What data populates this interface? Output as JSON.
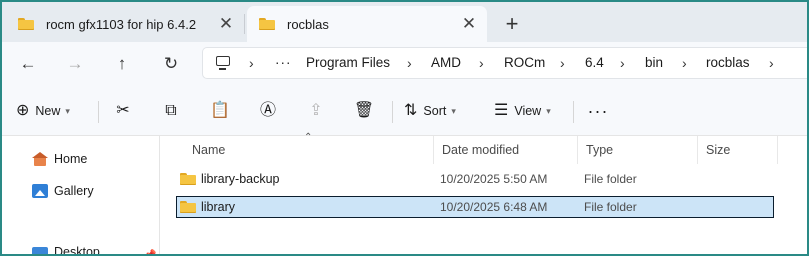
{
  "tabs": [
    {
      "label": "rocm gfx1103 for hip 6.4.2",
      "active": false
    },
    {
      "label": "rocblas",
      "active": true
    }
  ],
  "tab_close_glyph": "✕",
  "new_tab_glyph": "+",
  "nav": {
    "back": "←",
    "forward": "→",
    "up": "↑",
    "refresh": "↻"
  },
  "breadcrumb": {
    "overflow": "···",
    "items": [
      "Program Files",
      "AMD",
      "ROCm",
      "6.4",
      "bin",
      "rocblas"
    ],
    "separator": "›"
  },
  "toolbar": {
    "new_label": "New",
    "sort_label": "Sort",
    "view_label": "View",
    "more_glyph": "···",
    "icons": [
      "add-icon",
      "cut-icon",
      "copy-icon",
      "paste-icon",
      "rename-icon",
      "share-icon",
      "delete-icon",
      "sort-icon",
      "view-icon"
    ]
  },
  "nav_pane": {
    "items": [
      {
        "label": "Home",
        "icon": "home-icon"
      },
      {
        "label": "Gallery",
        "icon": "gallery-icon"
      },
      {
        "label": "Desktop",
        "icon": "desktop-icon"
      }
    ]
  },
  "columns": [
    "Name",
    "Date modified",
    "Type",
    "Size"
  ],
  "files": [
    {
      "name": "library-backup",
      "date": "10/20/2025 5:50 AM",
      "type": "File folder",
      "size": "",
      "selected": false
    },
    {
      "name": "library",
      "date": "10/20/2025 6:48 AM",
      "type": "File folder",
      "size": "",
      "selected": true
    }
  ],
  "colors": {
    "accent": "#0067c0",
    "selection": "#cce4f7",
    "folder": "#f5c542",
    "tabstrip": "#e6ebf0"
  }
}
